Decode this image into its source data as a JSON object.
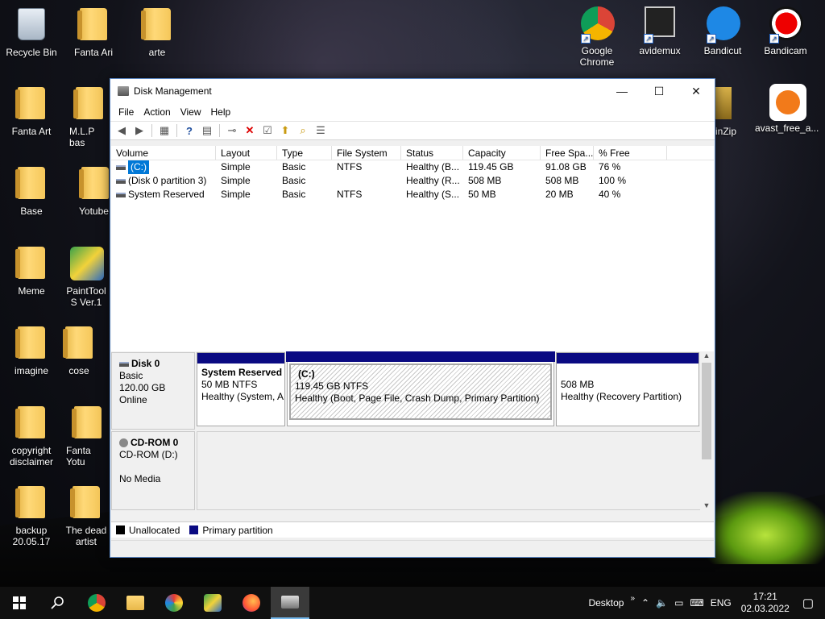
{
  "desktop": {
    "icons": [
      {
        "label": "Recycle Bin",
        "kind": "bin"
      },
      {
        "label": "Fanta Ari",
        "kind": "folder"
      },
      {
        "label": "arte",
        "kind": "folder"
      },
      {
        "label": "Fanta Art",
        "kind": "folder"
      },
      {
        "label": "M.L.P bas",
        "kind": "folder"
      },
      {
        "label": "Base",
        "kind": "folder"
      },
      {
        "label": "Yotube",
        "kind": "folder"
      },
      {
        "label": "Meme",
        "kind": "folder"
      },
      {
        "label": "PaintTool S Ver.1",
        "kind": "app"
      },
      {
        "label": "imagine",
        "kind": "folder"
      },
      {
        "label": "cose",
        "kind": "folder"
      },
      {
        "label": "copyright disclaimer",
        "kind": "folder"
      },
      {
        "label": "Fanta Yotu",
        "kind": "folder"
      },
      {
        "label": "backup 20.05.17",
        "kind": "folder"
      },
      {
        "label": "The dead artist",
        "kind": "folder"
      },
      {
        "label": "Google Chrome",
        "kind": "app"
      },
      {
        "label": "avidemux",
        "kind": "app"
      },
      {
        "label": "Bandicut",
        "kind": "app"
      },
      {
        "label": "Bandicam",
        "kind": "app"
      },
      {
        "label": "inZip",
        "kind": "app"
      },
      {
        "label": "avast_free_a...",
        "kind": "app"
      }
    ]
  },
  "window": {
    "title": "Disk Management",
    "menu": [
      "File",
      "Action",
      "View",
      "Help"
    ],
    "controls": {
      "minimize": "—",
      "maximize": "☐",
      "close": "✕"
    }
  },
  "volumes": {
    "columns": [
      "Volume",
      "Layout",
      "Type",
      "File System",
      "Status",
      "Capacity",
      "Free Spa...",
      "% Free"
    ],
    "rows": [
      [
        "(C:)",
        "Simple",
        "Basic",
        "NTFS",
        "Healthy (B...",
        "119.45 GB",
        "91.08 GB",
        "76 %"
      ],
      [
        "(Disk 0 partition 3)",
        "Simple",
        "Basic",
        "",
        "Healthy (R...",
        "508 MB",
        "508 MB",
        "100 %"
      ],
      [
        "System Reserved",
        "Simple",
        "Basic",
        "NTFS",
        "Healthy (S...",
        "50 MB",
        "20 MB",
        "40 %"
      ]
    ]
  },
  "disk0": {
    "name": "Disk 0",
    "type": "Basic",
    "size": "120.00 GB",
    "state": "Online",
    "partitions": [
      {
        "title": "System Reserved",
        "line1": "50 MB NTFS",
        "line2": "Healthy (System, A"
      },
      {
        "title": "(C:)",
        "line1": "119.45 GB NTFS",
        "line2": "Healthy (Boot, Page File, Crash Dump, Primary Partition)"
      },
      {
        "title": "",
        "line1": "508 MB",
        "line2": "Healthy (Recovery Partition)"
      }
    ]
  },
  "cdrom0": {
    "name": "CD-ROM 0",
    "drive": "CD-ROM (D:)",
    "media": "No Media"
  },
  "legend": {
    "unallocated": "Unallocated",
    "primary": "Primary partition",
    "unallocated_color": "#000000",
    "primary_color": "#0a0a82"
  },
  "taskbar": {
    "desktop_label": "Desktop",
    "lang": "ENG",
    "time": "17:21",
    "date": "02.03.2022"
  }
}
